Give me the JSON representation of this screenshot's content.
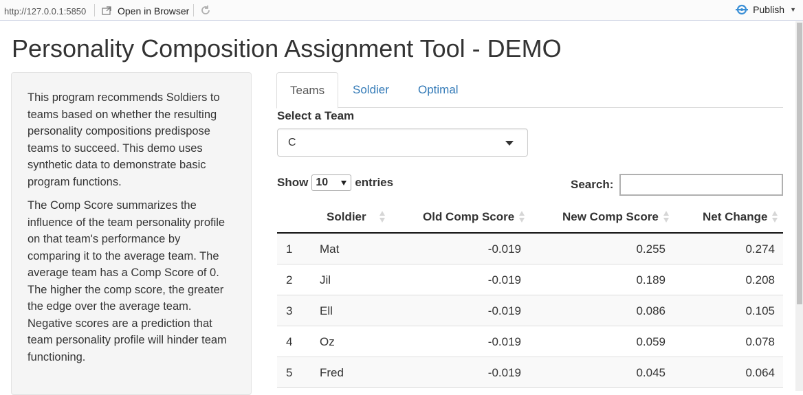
{
  "topbar": {
    "url": "http://127.0.0.1:5850",
    "open_browser_label": "Open in Browser",
    "publish_label": "Publish"
  },
  "page": {
    "title": "Personality Composition Assignment Tool - DEMO"
  },
  "sidebar": {
    "paragraphs": [
      "This program recommends Soldiers to teams based on whether the resulting personality compositions predispose teams to succeed. This demo uses synthetic data to demonstrate basic program functions.",
      "The Comp Score summarizes the influence of the team personality profile on that team's performance by comparing it to the average team. The average team has a Comp Score of 0. The higher the comp score, the greater the edge over the average team. Negative scores are a prediction that team personality profile will hinder team functioning."
    ]
  },
  "tabs": [
    {
      "label": "Teams",
      "active": true
    },
    {
      "label": "Soldier",
      "active": false
    },
    {
      "label": "Optimal",
      "active": false
    }
  ],
  "team_select": {
    "label": "Select a Team",
    "value": "C"
  },
  "table_controls": {
    "show_label": "Show",
    "length_value": "10",
    "entries_label": "entries",
    "search_label": "Search:",
    "search_value": ""
  },
  "table": {
    "headers": [
      "",
      "Soldier",
      "Old Comp Score",
      "New Comp Score",
      "Net Change"
    ],
    "rows": [
      [
        "1",
        "Mat",
        "-0.019",
        "0.255",
        "0.274"
      ],
      [
        "2",
        "Jil",
        "-0.019",
        "0.189",
        "0.208"
      ],
      [
        "3",
        "Ell",
        "-0.019",
        "0.086",
        "0.105"
      ],
      [
        "4",
        "Oz",
        "-0.019",
        "0.059",
        "0.078"
      ],
      [
        "5",
        "Fred",
        "-0.019",
        "0.045",
        "0.064"
      ]
    ]
  },
  "colors": {
    "link": "#337ab7",
    "sidebar_bg": "#f5f5f5"
  }
}
